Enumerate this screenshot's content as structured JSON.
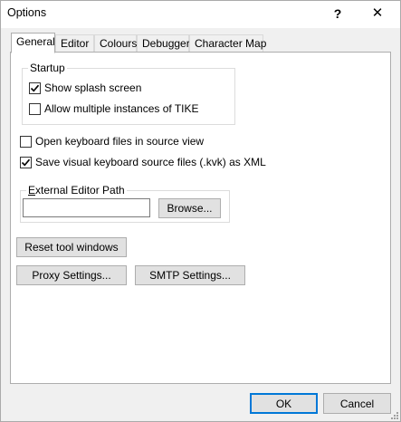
{
  "window": {
    "title": "Options",
    "help_glyph": "?",
    "close_glyph": "✕"
  },
  "tabs": [
    {
      "label": "General",
      "selected": true
    },
    {
      "label": "Editor",
      "selected": false
    },
    {
      "label": "Colours",
      "selected": false
    },
    {
      "label": "Debugger",
      "selected": false
    },
    {
      "label": "Character Map",
      "selected": false
    }
  ],
  "startup": {
    "legend": "Startup",
    "show_splash": {
      "label": "Show splash screen",
      "checked": true
    },
    "allow_multiple": {
      "label": "Allow multiple instances of TIKE",
      "checked": false
    }
  },
  "general": {
    "open_keyboard_source": {
      "label": "Open keyboard files in source view",
      "checked": false
    },
    "save_visual_xml": {
      "label": "Save visual keyboard source files (.kvk) as XML",
      "checked": true
    }
  },
  "external_editor": {
    "legend_accel": "E",
    "legend_rest": "xternal Editor Path",
    "value": "",
    "browse_label": "Browse..."
  },
  "buttons": {
    "reset_tool_windows": "Reset tool windows",
    "proxy_settings": "Proxy Settings...",
    "smtp_settings": "SMTP Settings...",
    "ok": "OK",
    "cancel": "Cancel"
  }
}
